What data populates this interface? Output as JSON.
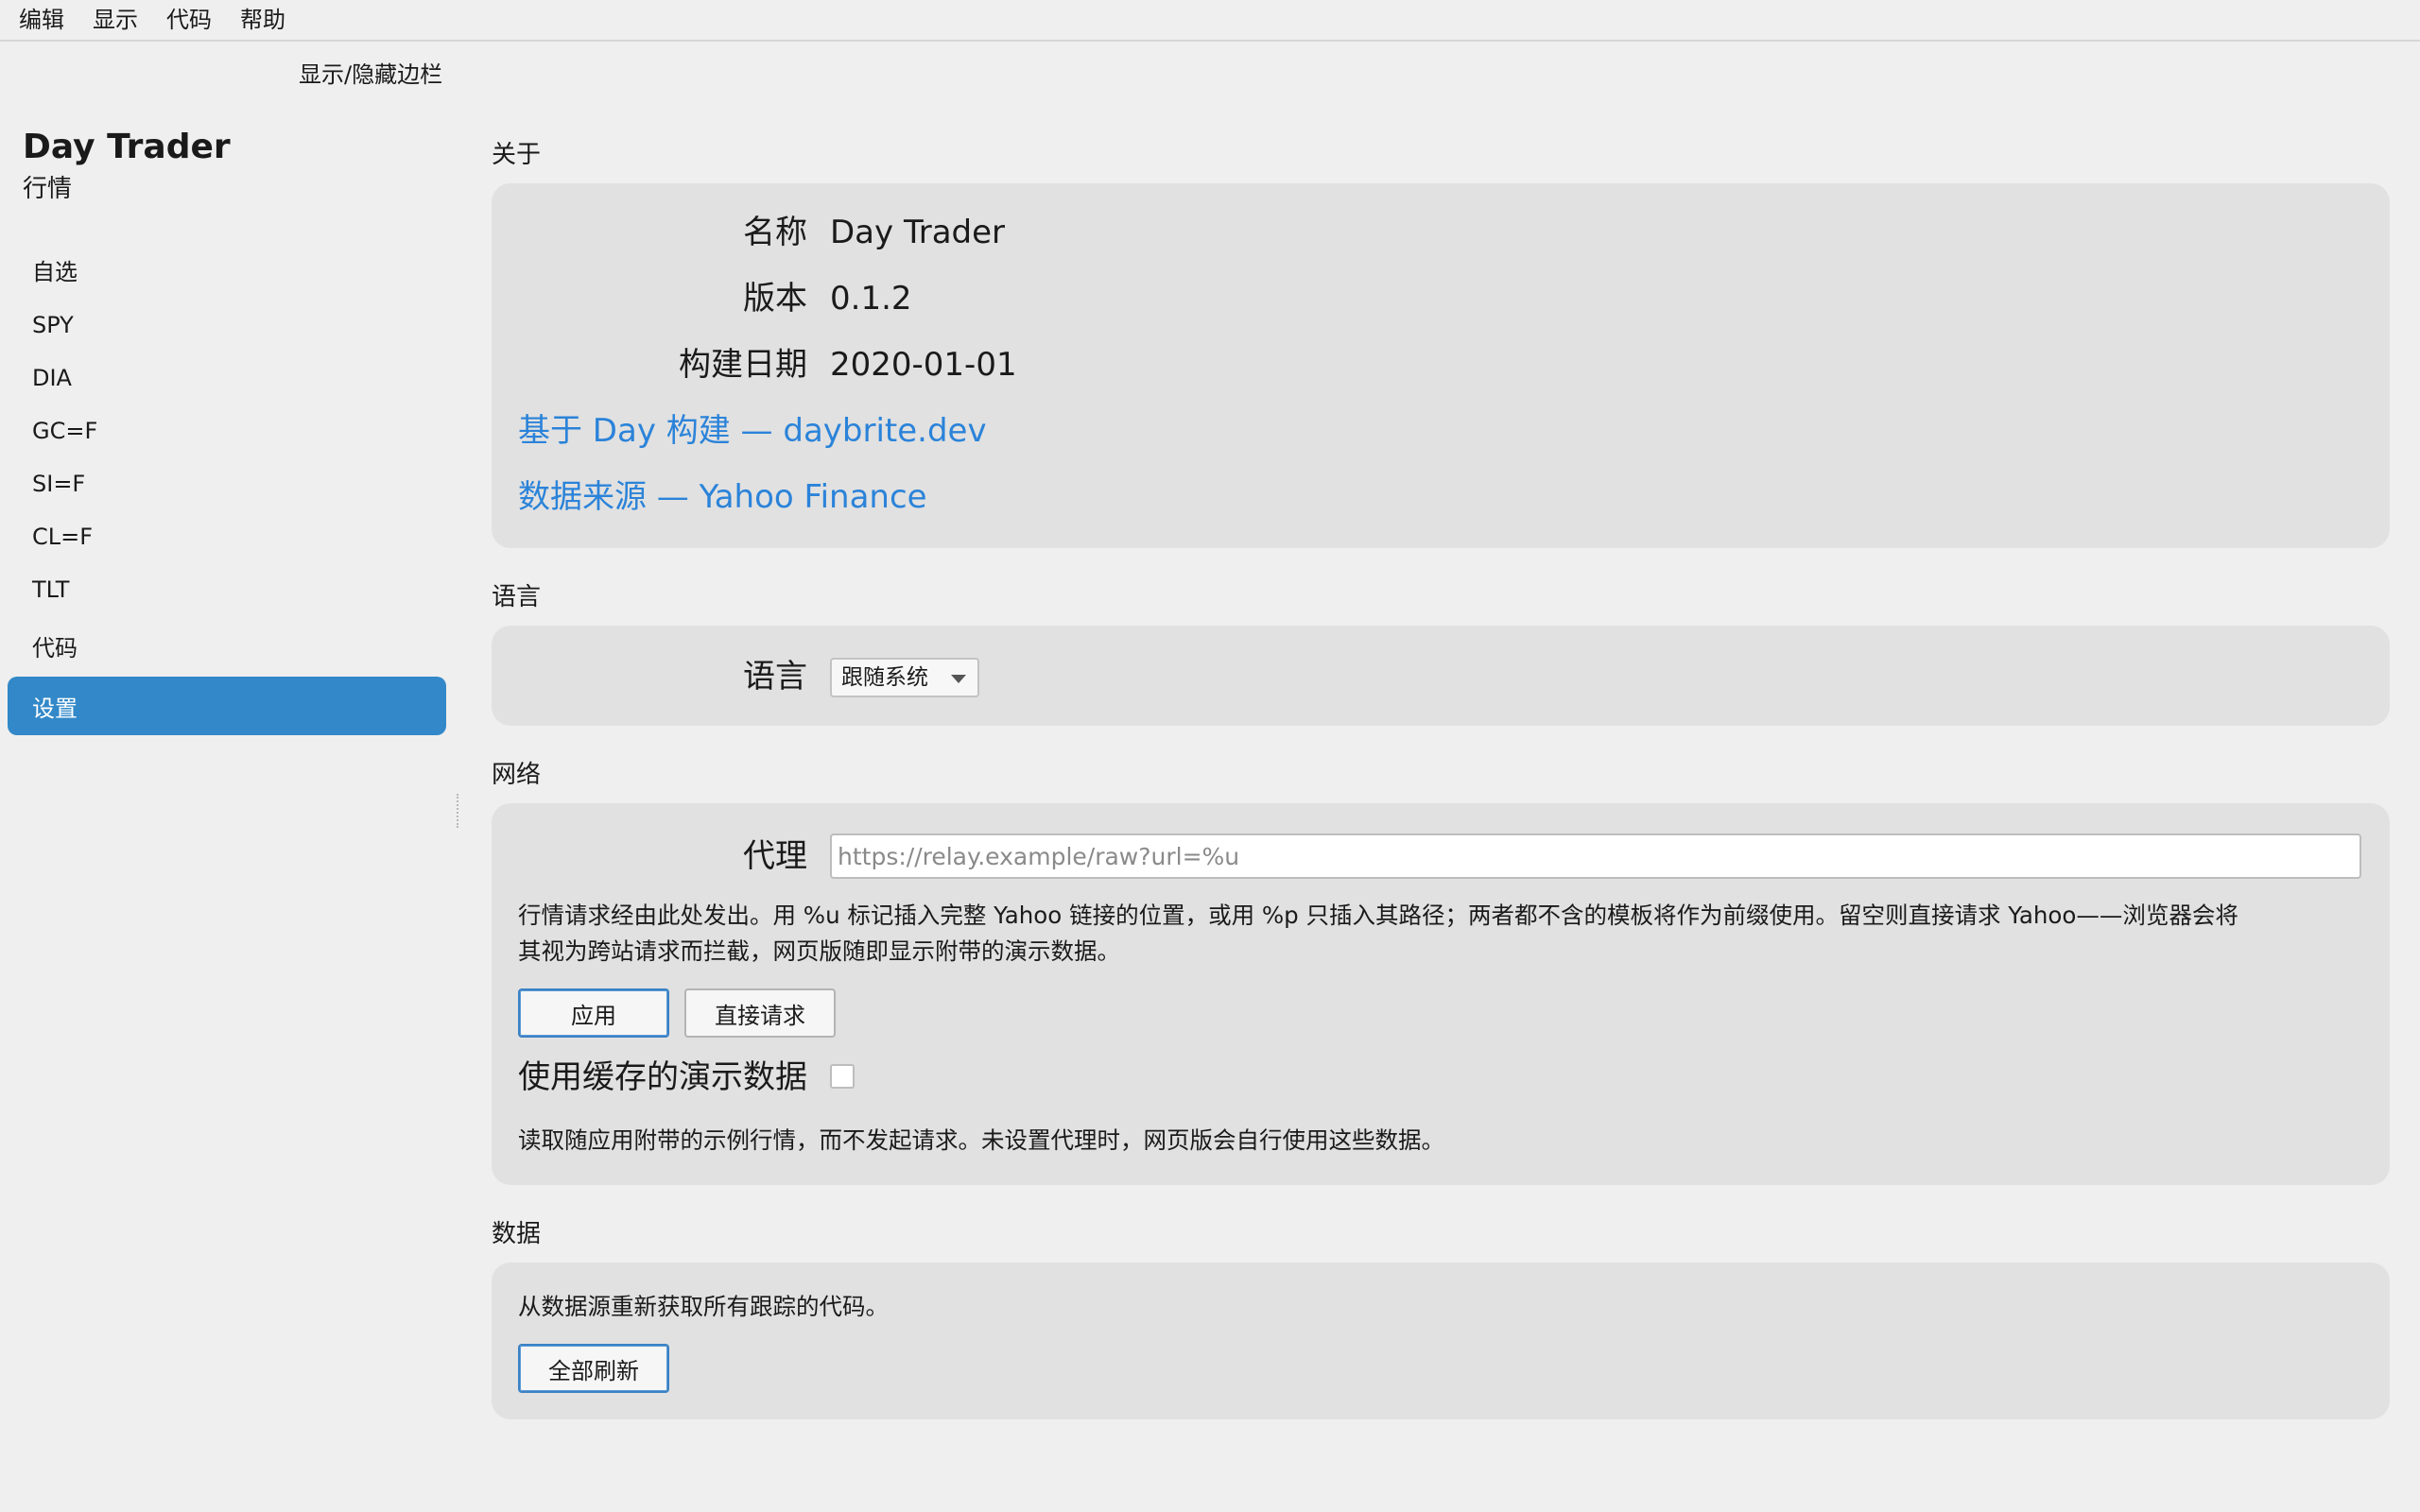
{
  "menubar": {
    "items": [
      {
        "label": "编辑"
      },
      {
        "label": "显示"
      },
      {
        "label": "代码"
      },
      {
        "label": "帮助"
      }
    ]
  },
  "sidebar": {
    "toggle_label": "显示/隐藏边栏",
    "app_title": "Day Trader",
    "app_subtitle": "行情",
    "items": [
      {
        "label": "自选"
      },
      {
        "label": "SPY"
      },
      {
        "label": "DIA"
      },
      {
        "label": "GC=F"
      },
      {
        "label": "SI=F"
      },
      {
        "label": "CL=F"
      },
      {
        "label": "TLT"
      },
      {
        "label": "代码"
      },
      {
        "label": "设置",
        "active": true
      }
    ]
  },
  "about": {
    "section_title": "关于",
    "name_label": "名称",
    "name_value": "Day Trader",
    "version_label": "版本",
    "version_value": "0.1.2",
    "build_date_label": "构建日期",
    "build_date_value": "2020-01-01",
    "built_with_link": "基于 Day 构建 — daybrite.dev",
    "data_source_link": "数据来源 — Yahoo Finance"
  },
  "language": {
    "section_title": "语言",
    "label": "语言",
    "selected": "跟随系统"
  },
  "network": {
    "section_title": "网络",
    "proxy_label": "代理",
    "proxy_value": "",
    "proxy_placeholder": "https://relay.example/raw?url=%u",
    "proxy_help_line1": "行情请求经由此处发出。用 %u 标记插入完整 Yahoo 链接的位置，或用 %p 只插入其路径；两者都不含的模板将作为前缀使用。留空则直接请求 Yahoo——浏览器会将",
    "proxy_help_line2": "其视为跨站请求而拦截，网页版随即显示附带的演示数据。",
    "apply_label": "应用",
    "direct_label": "直接请求",
    "cache_label": "使用缓存的演示数据",
    "cache_checked": false,
    "cache_help": "读取随应用附带的示例行情，而不发起请求。未设置代理时，网页版会自行使用这些数据。"
  },
  "data": {
    "section_title": "数据",
    "description": "从数据源重新获取所有跟踪的代码。",
    "refresh_all_label": "全部刷新"
  },
  "colors": {
    "accent": "#3288c8",
    "link": "#2b83d9",
    "panel": "#e1e1e1",
    "background": "#efefef"
  }
}
